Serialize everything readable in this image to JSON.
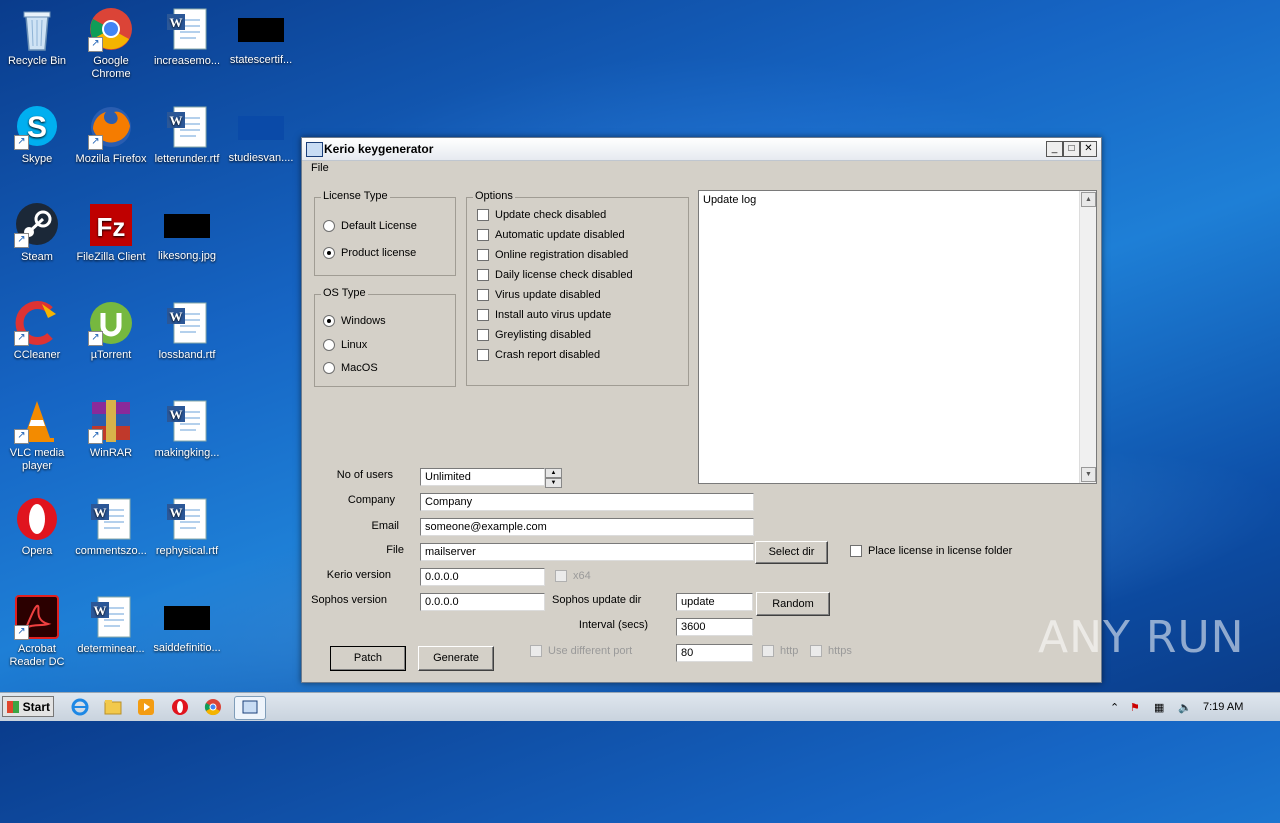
{
  "desktop": {
    "icons": [
      {
        "label": "Recycle Bin"
      },
      {
        "label": "Google Chrome"
      },
      {
        "label": "increasemo..."
      },
      {
        "label": "statescertif..."
      },
      {
        "label": "Skype"
      },
      {
        "label": "Mozilla Firefox"
      },
      {
        "label": "letterunder.rtf"
      },
      {
        "label": "studiesvan...."
      },
      {
        "label": "Steam"
      },
      {
        "label": "FileZilla Client"
      },
      {
        "label": "likesong.jpg"
      },
      {
        "label": "CCleaner"
      },
      {
        "label": "µTorrent"
      },
      {
        "label": "lossband.rtf"
      },
      {
        "label": "VLC media player"
      },
      {
        "label": "WinRAR"
      },
      {
        "label": "makingking..."
      },
      {
        "label": "Opera"
      },
      {
        "label": "commentszo..."
      },
      {
        "label": "rephysical.rtf"
      },
      {
        "label": "Acrobat Reader DC"
      },
      {
        "label": "determinear..."
      },
      {
        "label": "saiddefinitio..."
      }
    ]
  },
  "window": {
    "title": "Kerio keygenerator",
    "menu": {
      "file": "File"
    },
    "license_type": {
      "legend": "License Type",
      "options": [
        "Default License",
        "Product license"
      ],
      "selected": "Product license"
    },
    "os_type": {
      "legend": "OS Type",
      "options": [
        "Windows",
        "Linux",
        "MacOS"
      ],
      "selected": "Windows"
    },
    "options": {
      "legend": "Options",
      "items": [
        "Update check disabled",
        "Automatic update disabled",
        "Online registration disabled",
        "Daily license check disabled",
        "Virus update disabled",
        "Install auto virus update",
        "Greylisting disabled",
        "Crash report disabled"
      ]
    },
    "update_log": {
      "text": "Update log"
    },
    "form": {
      "users_label": "No of users",
      "users_value": "Unlimited",
      "company_label": "Company",
      "company_value": "Company",
      "email_label": "Email",
      "email_value": "someone@example.com",
      "file_label": "File",
      "file_value": "mailserver",
      "select_dir": "Select dir",
      "place_license": "Place license in license folder",
      "kerio_version_label": "Kerio version",
      "kerio_version_value": "0.0.0.0",
      "x64": "x64",
      "sophos_version_label": "Sophos version",
      "sophos_version_value": "0.0.0.0",
      "sophos_dir_label": "Sophos update dir",
      "sophos_dir_value": "update",
      "random": "Random",
      "interval_label": "Interval (secs)",
      "interval_value": "3600",
      "use_port": "Use different port",
      "port_value": "80",
      "http": "http",
      "https": "https",
      "patch": "Patch",
      "generate": "Generate"
    }
  },
  "taskbar": {
    "start": "Start",
    "clock": "7:19 AM"
  },
  "watermark": "ANY RUN"
}
